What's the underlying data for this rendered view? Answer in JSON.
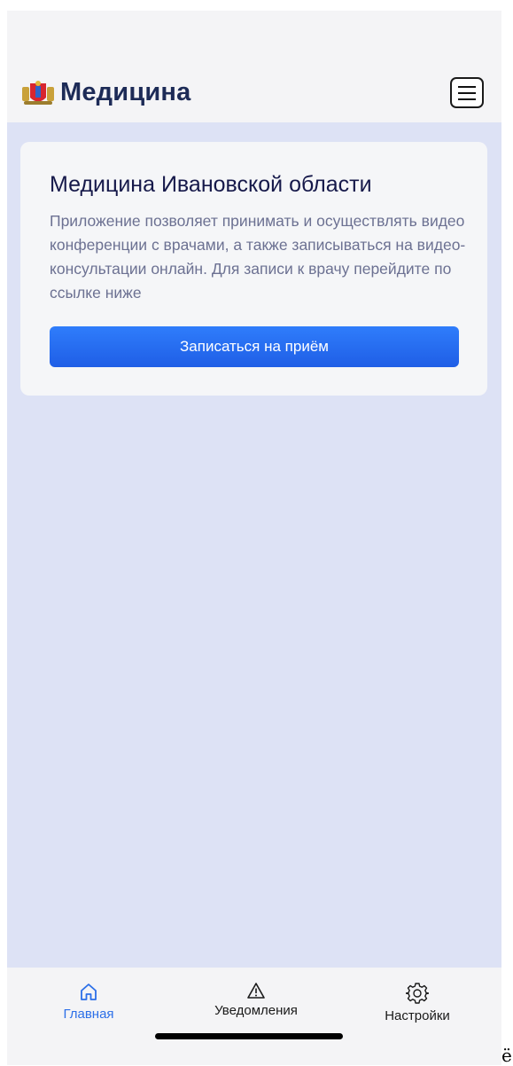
{
  "header": {
    "brand": "Медицина",
    "logo_icon": "regional-coat-of-arms-icon",
    "menu_icon": "hamburger-menu-icon"
  },
  "card": {
    "title": "Медицина Ивановской области",
    "description": "Приложение позволяет принимать и осуществлять видео конференции с врачами, а также записываться на видео-консультации онлайн. Для записи к врачу перейдите по ссылке ниже",
    "button_label": "Записаться на приём"
  },
  "tabbar": {
    "items": [
      {
        "label": "Главная",
        "icon": "home-icon",
        "active": true
      },
      {
        "label": "Уведомления",
        "icon": "warning-icon",
        "active": false
      },
      {
        "label": "Настройки",
        "icon": "gear-icon",
        "active": false
      }
    ]
  },
  "colors": {
    "brand_text": "#1d2b57",
    "content_background": "#dde2f5",
    "accent_button": "#2f7dfb",
    "active_tab": "#2c6fe8"
  },
  "stray_glyph": "ё"
}
